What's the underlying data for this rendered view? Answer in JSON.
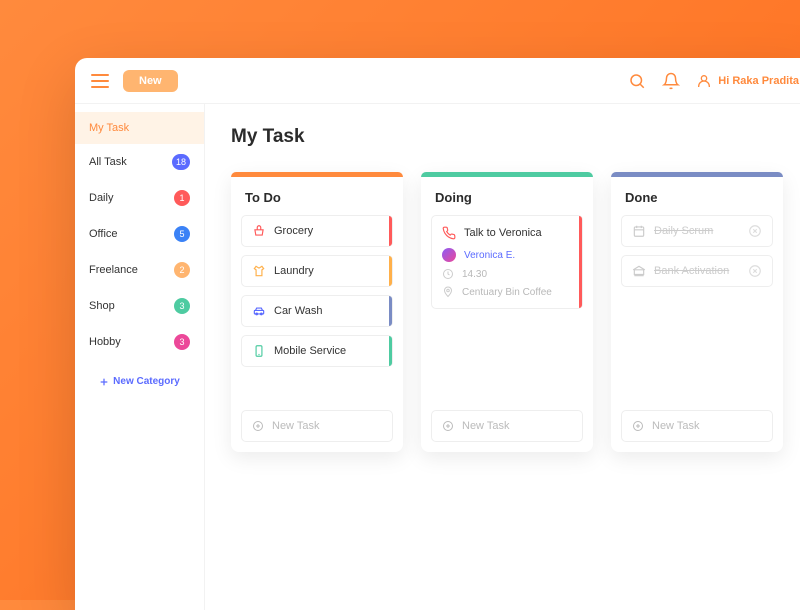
{
  "topbar": {
    "new_label": "New",
    "greeting": "Hi Raka Pradita"
  },
  "sidebar": {
    "items": [
      {
        "label": "My Task",
        "badge": null,
        "active": true
      },
      {
        "label": "All Task",
        "badge": "18",
        "color": "#5b6bff"
      },
      {
        "label": "Daily",
        "badge": "1",
        "color": "#ff5a5a"
      },
      {
        "label": "Office",
        "badge": "5",
        "color": "#3b82f6"
      },
      {
        "label": "Freelance",
        "badge": "2",
        "color": "#ffb570"
      },
      {
        "label": "Shop",
        "badge": "3",
        "color": "#4ecba1"
      },
      {
        "label": "Hobby",
        "badge": "3",
        "color": "#ec4899"
      }
    ],
    "new_category_label": "New Category"
  },
  "main": {
    "title": "My Task",
    "columns": {
      "todo": {
        "title": "To Do",
        "tasks": [
          {
            "label": "Grocery",
            "icon_color": "#ff5a5a",
            "stripe": "#ff5a5a"
          },
          {
            "label": "Laundry",
            "icon_color": "#ffb04a",
            "stripe": "#ffb04a"
          },
          {
            "label": "Car Wash",
            "icon_color": "#5b6bff",
            "stripe": "#7a8cc4"
          },
          {
            "label": "Mobile Service",
            "icon_color": "#4ecba1",
            "stripe": "#4ecba1"
          }
        ]
      },
      "doing": {
        "title": "Doing",
        "task": {
          "label": "Talk to Veronica",
          "person": "Veronica E.",
          "time": "14.30",
          "location": "Centuary Bin Coffee"
        }
      },
      "done": {
        "title": "Done",
        "tasks": [
          {
            "label": "Daily Scrum"
          },
          {
            "label": "Bank Activation"
          }
        ]
      }
    },
    "new_task_label": "New Task"
  }
}
